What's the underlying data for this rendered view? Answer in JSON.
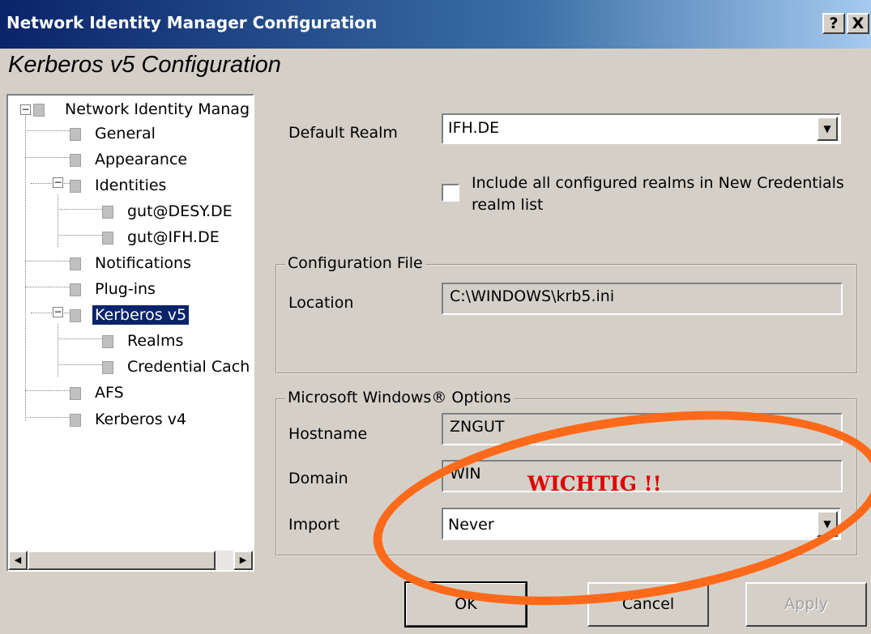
{
  "window": {
    "title": "Network Identity Manager Configuration",
    "help_btn": "?",
    "close_btn": "X"
  },
  "page_title": "Kerberos v5 Configuration",
  "tree": {
    "items": [
      {
        "label": "Network Identity Manag"
      },
      {
        "label": "General"
      },
      {
        "label": "Appearance"
      },
      {
        "label": "Identities"
      },
      {
        "label": "gut@DESY.DE"
      },
      {
        "label": "gut@IFH.DE"
      },
      {
        "label": "Notifications"
      },
      {
        "label": "Plug-ins"
      },
      {
        "label": "Kerberos v5"
      },
      {
        "label": "Realms"
      },
      {
        "label": "Credential Cach"
      },
      {
        "label": "AFS"
      },
      {
        "label": "Kerberos v4"
      }
    ]
  },
  "default_realm": {
    "label": "Default Realm",
    "value": "IFH.DE"
  },
  "include_realms": {
    "label_line1": "Include all configured realms in New Credentials",
    "label_line2": "realm list",
    "checked": false
  },
  "config_file": {
    "legend": "Configuration File",
    "location_label": "Location",
    "location_value": "C:\\WINDOWS\\krb5.ini"
  },
  "windows_options": {
    "legend": "Microsoft Windows® Options",
    "hostname_label": "Hostname",
    "hostname_value": "ZNGUT",
    "domain_label": "Domain",
    "domain_value": "WIN",
    "import_label": "Import",
    "import_value": "Never"
  },
  "buttons": {
    "ok": "OK",
    "cancel": "Cancel",
    "apply": "Apply"
  },
  "annotation": {
    "text": "WICHTIG !!",
    "color": "#e00000",
    "ellipse_color": "#ff6a1a"
  }
}
